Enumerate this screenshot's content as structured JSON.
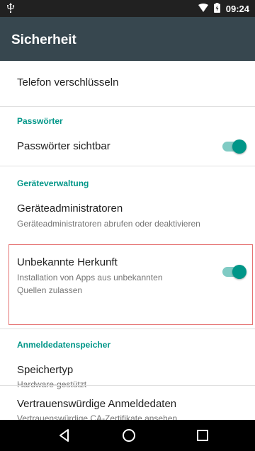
{
  "status_bar": {
    "time": "09:24",
    "icons": [
      "usb-icon",
      "wifi-icon",
      "battery-charging-icon"
    ]
  },
  "app_bar": {
    "title": "Sicherheit"
  },
  "settings": {
    "phone_encrypt": {
      "title": "Telefon verschlüsseln"
    },
    "passwords": {
      "category": "Passwörter",
      "show_passwords": {
        "title": "Passwörter sichtbar",
        "enabled": true
      }
    },
    "device_admin": {
      "category": "Geräteverwaltung",
      "admins": {
        "title": "Geräteadministratoren",
        "summary": "Geräteadministratoren abrufen oder deaktivieren"
      },
      "unknown_sources": {
        "title": "Unbekannte Herkunft",
        "summary_line1": "Installation von Apps aus unbekannten",
        "summary_line2": "Quellen zulassen",
        "enabled": true
      }
    },
    "credential_storage": {
      "category": "Anmeldedatenspeicher",
      "storage_type": {
        "title": "Speichertyp",
        "summary": "Hardware-gestützt"
      },
      "trusted_credentials": {
        "title": "Vertrauenswürdige Anmeldedaten",
        "summary": "Vertrauenswürdige CA-Zertifikate ansehen"
      }
    }
  },
  "nav_bar": {
    "buttons": [
      "back-icon",
      "home-icon",
      "recents-icon"
    ]
  },
  "colors": {
    "accent": "#009688",
    "app_bar": "#37474f",
    "status_bar": "#212121",
    "highlight_border": "#e57373"
  }
}
